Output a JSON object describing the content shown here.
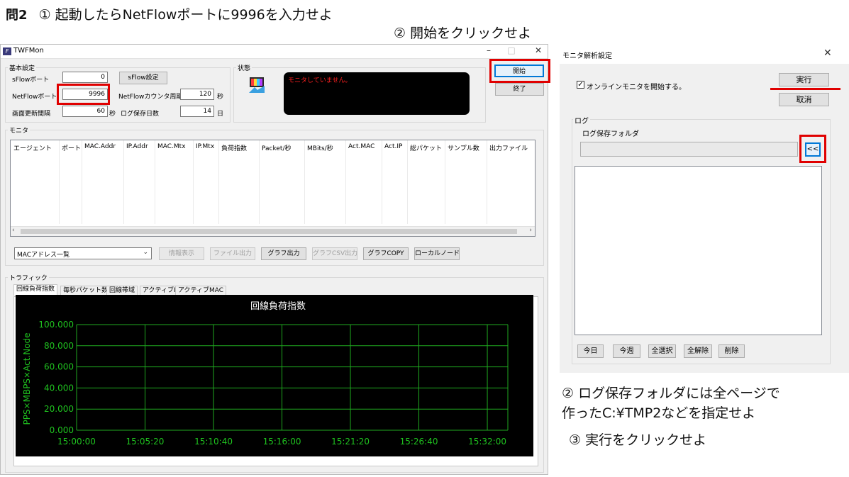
{
  "instructions": {
    "question_label": "問2",
    "step1": "① 起動したらNetFlowポートに9996を入力せよ",
    "step2": "② 開始をクリックせよ",
    "step2b_line1": "② ログ保存フォルダには全ページで",
    "step2b_line2": "作ったC:¥TMP2などを指定せよ",
    "step3": "③ 実行をクリックせよ"
  },
  "twfmon": {
    "title": "TWFMon",
    "icon_letter": "F",
    "minimize": "–",
    "maximize": "□",
    "close": "✕",
    "basic_settings": {
      "group_label": "基本設定",
      "sflow_port_label": "sFlowポート",
      "sflow_port_value": "0",
      "sflow_settings_button": "sFlow設定",
      "netflow_port_label": "NetFlowポート",
      "netflow_port_value": "9996",
      "netflow_counter_label": "NetFlowカウンタ周期",
      "netflow_counter_value": "120",
      "netflow_counter_unit": "秒",
      "refresh_label": "画面更新間隔",
      "refresh_value": "60",
      "refresh_unit": "秒",
      "log_days_label": "ログ保存日数",
      "log_days_value": "14",
      "log_days_unit": "日"
    },
    "status": {
      "group_label": "状態",
      "message": "モニタしていません。"
    },
    "start_button": "開始",
    "end_button": "終了",
    "monitor": {
      "group_label": "モニタ",
      "columns": [
        "エージェント",
        "ポート",
        "MAC.Addr",
        "IP.Addr",
        "MAC.Mtx",
        "IP.Mtx",
        "負荷指数",
        "Packet/秒",
        "MBits/秒",
        "Act.MAC",
        "Act.IP",
        "総パケット",
        "サンプル数",
        "出力ファイル"
      ],
      "select_value": "MACアドレス一覧",
      "buttons": {
        "info": "情報表示",
        "file_out": "ファイル出力",
        "graph_out": "グラフ出力",
        "graph_csv": "グラフCSV出力",
        "graph_copy": "グラフCOPY",
        "local_node": "ローカルノード"
      }
    },
    "traffic": {
      "group_label": "トラフィック",
      "tabs": [
        "回線負荷指数",
        "毎秒パケット数",
        "回線帯域",
        "アクティブIP",
        "アクティブMAC"
      ]
    }
  },
  "chart_data": {
    "type": "line",
    "title": "回線負荷指数",
    "ylabel": "PPS×MBPS×Act.Node",
    "ylim": [
      0,
      100
    ],
    "y_ticks": [
      "100.000",
      "80.000",
      "60.000",
      "40.000",
      "20.000",
      "0.000"
    ],
    "x_ticks": [
      "15:00:00",
      "15:05:20",
      "15:10:40",
      "15:16:00",
      "15:21:20",
      "15:26:40",
      "15:32:00"
    ],
    "series": [],
    "grid": true,
    "colors": {
      "background": "#000000",
      "grid": "#1fa81f",
      "text": "#1fc21f",
      "title": "#ffffff"
    }
  },
  "dialog": {
    "title": "モニタ解析設定",
    "close": "✕",
    "online_check_label": "オンラインモニタを開始する。",
    "online_checked": "✓",
    "run_button": "実行",
    "cancel_button": "取消",
    "log_group_label": "ログ",
    "log_folder_label": "ログ保存フォルダ",
    "log_folder_value": "",
    "browse_button": "<<",
    "buttons": {
      "today": "今日",
      "this_week": "今週",
      "select_all": "全選択",
      "deselect_all": "全解除",
      "delete": "削除"
    }
  },
  "colors": {
    "highlight_red": "#e00000",
    "status_text": "#ff2020"
  }
}
